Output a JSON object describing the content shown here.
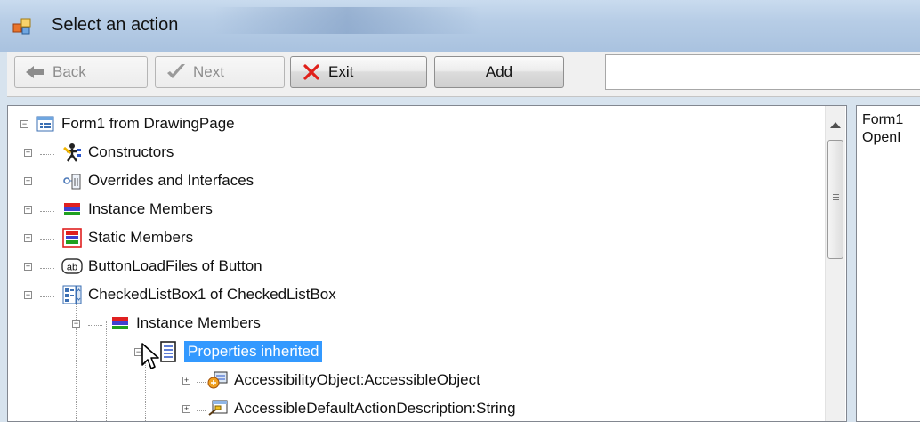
{
  "window": {
    "title": "Select an action"
  },
  "toolbar": {
    "back_label": "Back",
    "next_label": "Next",
    "exit_label": "Exit",
    "add_label": "Add",
    "input_value": ""
  },
  "tree": {
    "items": [
      {
        "label": "Form1 from DrawingPage",
        "icon": "form-icon",
        "expander": "minus"
      },
      {
        "label": "Constructors",
        "icon": "constructor-icon",
        "expander": "plus"
      },
      {
        "label": "Overrides and Interfaces",
        "icon": "interface-icon",
        "expander": "plus"
      },
      {
        "label": "Instance Members",
        "icon": "members-icon",
        "expander": "plus"
      },
      {
        "label": "Static Members",
        "icon": "static-members-icon",
        "expander": "plus"
      },
      {
        "label": "ButtonLoadFiles of Button",
        "icon": "button-ab-icon",
        "expander": "plus"
      },
      {
        "label": "CheckedListBox1 of CheckedListBox",
        "icon": "checkedlistbox-icon",
        "expander": "minus"
      },
      {
        "label": "Instance Members",
        "icon": "members-icon",
        "expander": "minus"
      },
      {
        "label": "Properties inherited",
        "icon": "properties-icon",
        "expander": "minus",
        "selected": true
      },
      {
        "label": "AccessibilityObject:AccessibleObject",
        "icon": "property-object-icon",
        "expander": "plus"
      },
      {
        "label": "AccessibleDefaultActionDescription:String",
        "icon": "property-string-icon",
        "expander": "plus"
      }
    ]
  },
  "right_panel": {
    "lines": [
      "Form1",
      "OpenI"
    ]
  },
  "colors": {
    "selection": "#3399ff",
    "titlebar": "#b7cde6"
  }
}
